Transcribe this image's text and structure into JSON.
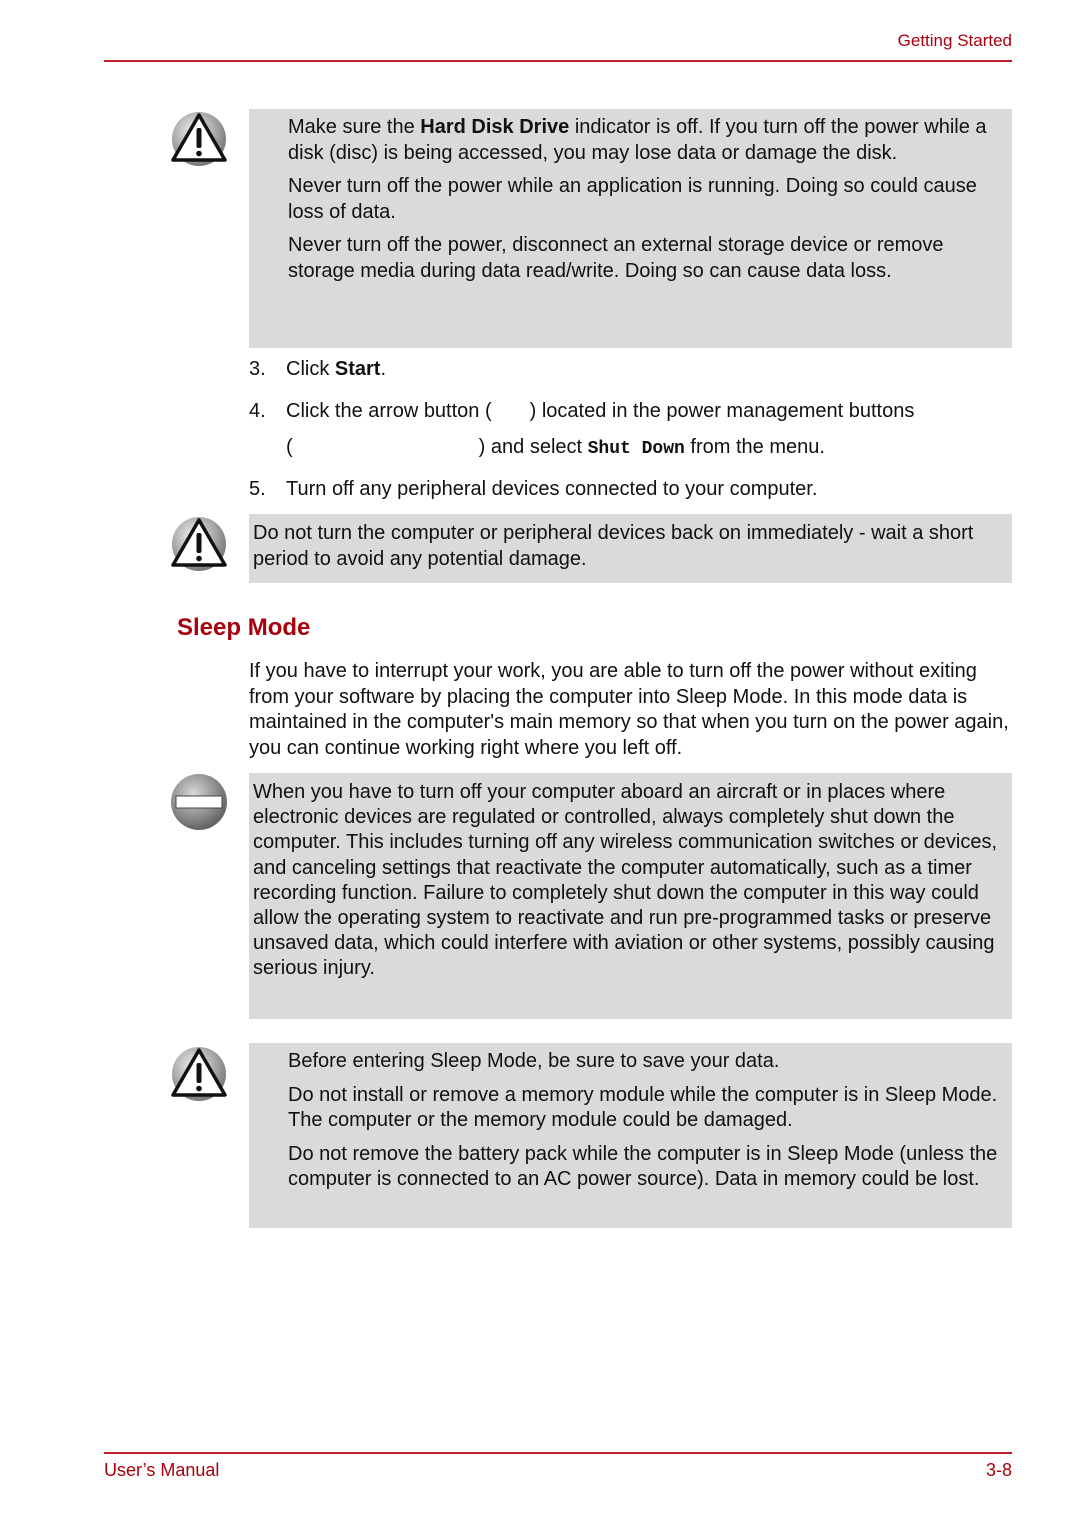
{
  "header": {
    "section": "Getting Started"
  },
  "caution1": {
    "p1_pre": "Make sure the ",
    "p1_bold": "Hard Disk Drive",
    "p1_post": " indicator is off. If you turn off the power while a disk (disc) is being accessed, you may lose data or damage the disk.",
    "p2": "Never turn off the power while an application is running. Doing so could cause loss of data.",
    "p3": "Never turn off the power, disconnect an external storage device or remove storage media during data read/write. Doing so can cause data loss."
  },
  "steps": [
    {
      "num": "3.",
      "pre": "Click ",
      "bold": "Start",
      "post": "."
    },
    {
      "num": "4.",
      "line1": "Click the arrow button (",
      "line1b": ") located in the power management buttons",
      "line2a": "(",
      "line2b": ") and select ",
      "mono": "Shut Down",
      "line2c": " from the menu."
    },
    {
      "num": "5.",
      "text": "Turn off any peripheral devices connected to your computer."
    }
  ],
  "caution2": {
    "text": "Do not turn the computer or peripheral devices back on immediately - wait a short period to avoid any potential damage."
  },
  "section": {
    "title": "Sleep Mode",
    "intro": "If you have to interrupt your work, you are able to turn off the power without exiting from your software by placing the computer into Sleep Mode. In this mode data is maintained in the computer's main memory so that when you turn on the power again, you can continue working right where you left off."
  },
  "prohibited": {
    "text": "When you have to turn off your computer aboard an aircraft or in places where electronic devices are regulated or controlled, always completely shut down the computer. This includes turning off any wireless communication switches or devices, and canceling settings that reactivate the computer automatically, such as a timer recording function. Failure to completely shut down the computer in this way could allow the operating system to reactivate and run pre-programmed tasks or preserve unsaved data, which could interfere with aviation or other systems, possibly causing serious injury."
  },
  "caution3": {
    "p1": "Before entering Sleep Mode, be sure to save your data.",
    "p2": "Do not install or remove a memory module while the computer is in Sleep Mode. The computer or the memory module could be damaged.",
    "p3": "Do not remove the battery pack while the computer is in Sleep Mode (unless the computer is connected to an AC power source). Data in memory could be lost."
  },
  "footer": {
    "left": "User’s Manual",
    "right": "3-8"
  }
}
